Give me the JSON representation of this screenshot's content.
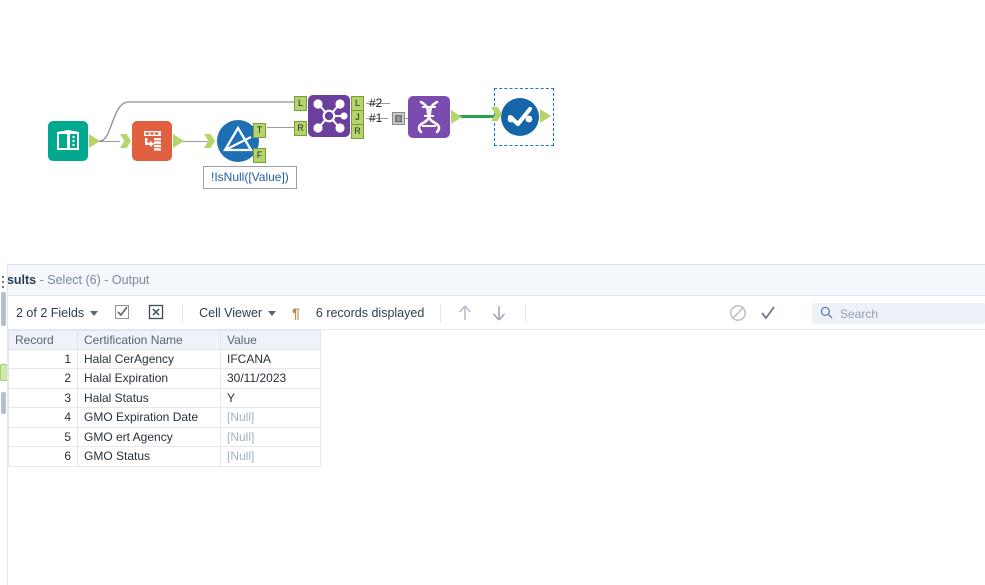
{
  "canvas": {
    "tools": [
      {
        "id": "input-data",
        "name": "input-data-tool",
        "icon": "book-icon",
        "color": "#00a890"
      },
      {
        "id": "transpose",
        "name": "transpose-tool",
        "icon": "transpose-icon",
        "color": "#e0603f"
      },
      {
        "id": "filter",
        "name": "filter-tool",
        "icon": "filter-icon",
        "color": "#1f6fb4"
      },
      {
        "id": "join",
        "name": "join-tool",
        "icon": "join-icon",
        "color": "#6b3f9e"
      },
      {
        "id": "crosstab",
        "name": "data-cleansing-tool",
        "icon": "dna-helix-icon",
        "color": "#7a4cae"
      },
      {
        "id": "select",
        "name": "select-tool",
        "icon": "select-check-icon",
        "color": "#1565a8"
      }
    ],
    "filter_expression": "!IsNull([Value])",
    "connection_labels": [
      "#2",
      "#1"
    ],
    "anchors": {
      "filter_true": "T",
      "filter_false": "F",
      "join_left_in": "L",
      "join_right_in": "R",
      "join_left_out": "L",
      "join_join_out": "J",
      "join_right_out": "R"
    }
  },
  "results": {
    "title_main": "esults",
    "title_sub": " - Select (6) - Output",
    "toolbar": {
      "fields_label": "2 of 2 Fields",
      "check_icon": "checkbox-checked-icon",
      "deselect_icon": "checkbox-x-icon",
      "view_label": "Cell Viewer",
      "pilcrow_icon": "pilcrow-icon",
      "records_label": "6 records displayed",
      "up_icon": "arrow-up-icon",
      "down_icon": "arrow-down-icon",
      "block_icon": "no-entry-icon",
      "check_mark_icon": "check-icon",
      "search_icon": "search-icon",
      "search_placeholder": "Search",
      "search_value": ""
    },
    "table": {
      "columns": [
        "Record",
        "Certification Name",
        "Value"
      ],
      "rows": [
        {
          "record": "1",
          "name": "Halal CerAgency",
          "value": "IFCANA",
          "null": false
        },
        {
          "record": "2",
          "name": "Halal Expiration",
          "value": "30/11/2023",
          "null": false
        },
        {
          "record": "3",
          "name": "Halal Status",
          "value": "Y",
          "null": false
        },
        {
          "record": "4",
          "name": "GMO Expiration Date",
          "value": "[Null]",
          "null": true
        },
        {
          "record": "5",
          "name": "GMO ert Agency",
          "value": "[Null]",
          "null": true
        },
        {
          "record": "6",
          "name": "GMO Status",
          "value": "[Null]",
          "null": true
        }
      ]
    }
  }
}
